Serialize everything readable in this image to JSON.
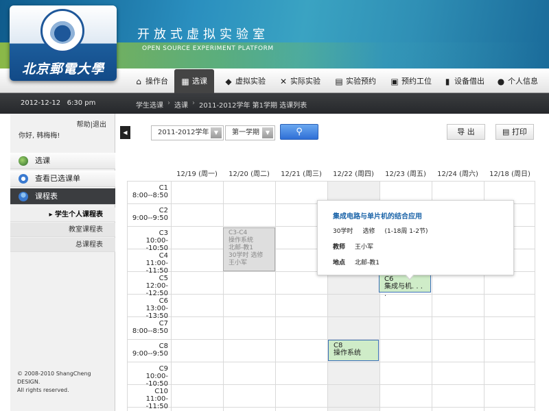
{
  "logo": {
    "text": "北京郵電大學"
  },
  "header": {
    "title_cn": "开放式虚拟实验室",
    "title_en": "OPEN SOURCE EXPERIMENT PLATFORM"
  },
  "nav": [
    {
      "label": "操作台",
      "icon": "home-icon"
    },
    {
      "label": "选课",
      "icon": "grid-icon",
      "active": true
    },
    {
      "label": "虚拟实验",
      "icon": "cube-icon"
    },
    {
      "label": "实际实验",
      "icon": "tools-icon"
    },
    {
      "label": "实验预约",
      "icon": "window-icon"
    },
    {
      "label": "预约工位",
      "icon": "calendar-icon"
    },
    {
      "label": "设备借出",
      "icon": "book-icon"
    },
    {
      "label": "个人信息",
      "icon": "user-icon"
    }
  ],
  "status": {
    "date": "2012-12-12",
    "time": "6:30 pm"
  },
  "breadcrumb": [
    "学生选课",
    "选课",
    "2011-2012学年 第1学期 选课列表"
  ],
  "sidebar": {
    "links": "帮助|退出",
    "greeting": "你好, 韩梅梅!",
    "items": [
      {
        "label": "选课",
        "icon": "globe-icon"
      },
      {
        "label": "查看已选课单",
        "icon": "at-icon"
      },
      {
        "label": "课程表",
        "icon": "user-icon"
      }
    ],
    "subitems": [
      {
        "label": "学生个人课程表",
        "active": true
      },
      {
        "label": "教室课程表"
      },
      {
        "label": "总课程表"
      }
    ],
    "copyright_1": "© 2008-2010 ShangCheng DESIGN.",
    "copyright_2": "All rights reserved."
  },
  "toolbar": {
    "year": "2011-2012学年",
    "term": "第一学期",
    "export_label": "导 出",
    "print_label": "打印"
  },
  "schedule": {
    "days": [
      "12/19 (周一)",
      "12/20 (周二)",
      "12/21 (周三)",
      "12/22 (周四)",
      "12/23 (周五)",
      "12/24 (周六)",
      "12/18 (周日)"
    ],
    "slots": [
      {
        "code": "C1",
        "time": "8:00--8:50"
      },
      {
        "code": "C2",
        "time": "9:00--9:50"
      },
      {
        "code": "C3",
        "time": "10:00--10:50"
      },
      {
        "code": "C4",
        "time": "11:00--11:50"
      },
      {
        "code": "C5",
        "time": "12:00--12:50"
      },
      {
        "code": "C6",
        "time": "13:00--13:50"
      },
      {
        "code": "C7",
        "time": "8:00--8:50"
      },
      {
        "code": "C8",
        "time": "9:00--9:50"
      },
      {
        "code": "C9",
        "time": "10:00--10:50"
      },
      {
        "code": "C10",
        "time": "11:00--11:50"
      }
    ],
    "course_grey": {
      "line1": "C3-C4",
      "line2": "操作系统",
      "line3": "北邮-教1",
      "line4": "30学时 选修",
      "line5": "王小军"
    },
    "course_fri": {
      "line1": "C6",
      "line2": "集成与机. . . ."
    },
    "course_thu": {
      "line1": "C8",
      "line2": "操作系统"
    }
  },
  "popup": {
    "title": "集成电路与单片机的结合应用",
    "hours": "30学时",
    "type": "选修",
    "weeks": "(1-18周  1-2节)",
    "teacher_label": "教师",
    "teacher": "王小军",
    "place_label": "地点",
    "place": "北邮-教1"
  },
  "colors": {
    "accent_blue": "#2f6fd6",
    "course_green": "#cfecc8",
    "link_blue": "#1a63a8"
  }
}
